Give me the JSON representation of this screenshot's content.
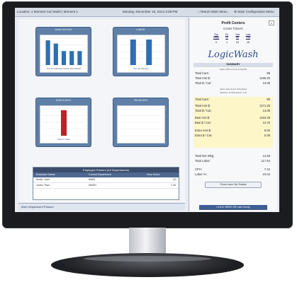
{
  "topbar": {
    "location": "Location: 1 Moment Car Wash | Moment 1",
    "date": "Monday, December 15, 2014 3:08 PM",
    "return_main": "Return Main Menu",
    "config_menu": "Main Configuration Menu"
  },
  "dashboard": {
    "panels": [
      {
        "title": "WASH BOOKS",
        "bars": [
          0.92,
          0.8,
          0.52,
          0.52,
          0.52
        ],
        "labels": "The Jet  Ultimate  Deluxe  Speedwash",
        "color": "#2f6fb0"
      },
      {
        "title": "LABOR",
        "bars": [
          0.95,
          0.95
        ],
        "labels": "The Jet  Ultimate",
        "color": "#2f6fb0"
      },
      {
        "title": "DISCOUNTS",
        "bars": [
          0.95
        ],
        "labels": "Fleet in Coke",
        "color": "#c0202a"
      },
      {
        "title": "PACKAGES",
        "bars": [],
        "labels": "",
        "color": "#2f6fb0"
      }
    ],
    "table": {
      "title": "Employee Present  (All Departments)",
      "headers": [
        "Employee Name",
        "Current Department",
        "Hour Hours"
      ],
      "rows": [
        [
          "Smith, John",
          "MAIN",
          "24"
        ],
        [
          "Jones, Paul",
          "WASH",
          "7.40"
        ]
      ]
    },
    "bottom_tab": "Main Department Present"
  },
  "sidebar": {
    "title": "Profit Centers",
    "close": "x",
    "subtitle": "CASH TODAY",
    "days": [
      {
        "label": [
          "Thu",
          "Days"
        ],
        "count": "0"
      },
      {
        "label": [
          "Fri",
          "Hr"
        ],
        "count": "1"
      },
      {
        "label": [
          "Sat",
          "All"
        ],
        "count": "24"
      },
      {
        "label": [
          "Last",
          "Yds"
        ],
        "count": "45"
      }
    ],
    "logo": "LogicWash",
    "summary_header": "SUMMARY",
    "note1": "Labor before hours & Vehicle",
    "note2": "Labor after Hours Scheduled",
    "note3": "Vehicles: 11/100  Actual: 1.67",
    "lines": [
      {
        "label": "Total Cars:",
        "value": "89"
      },
      {
        "label": "Total Amt $:",
        "value": "1165.25"
      },
      {
        "label": "Total $ / Car:",
        "value": "13.09"
      },
      {
        "label": "Total Cars:",
        "value": "89"
      },
      {
        "label": "Total Amt $:",
        "value": "1171.25"
      },
      {
        "label": "Total $ / Car:",
        "value": "13.05"
      },
      {
        "label": "Basi Amt $:",
        "value": "1163.25"
      },
      {
        "label": "Basi $ / Car:",
        "value": "13.75"
      },
      {
        "label": "Extra Amt $:",
        "value": "8.00"
      },
      {
        "label": "Extra $ / Car:",
        "value": "0.09"
      },
      {
        "label": "Total Net Wkg:",
        "value": "12.59"
      },
      {
        "label": "Total Labor:",
        "value": "117.64"
      },
      {
        "label": "CPH:",
        "value": "7.42"
      },
      {
        "label": "Labor %:",
        "value": "10.04"
      }
    ],
    "button": "Show Labor By Grades",
    "bottom_bar": "CLICK HERE OR Last Hourly"
  }
}
